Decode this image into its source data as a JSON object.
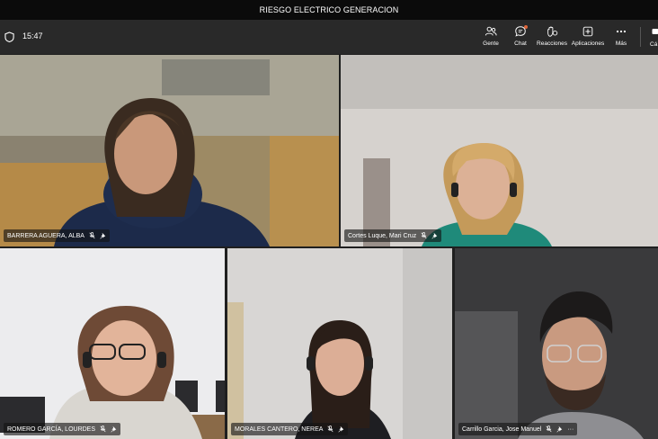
{
  "window": {
    "title": "RIESGO ELECTRICO GENERACION"
  },
  "toolbar": {
    "timer": "15:47",
    "buttons": [
      {
        "label": "Gente",
        "icon": "people-icon"
      },
      {
        "label": "Chat",
        "icon": "chat-icon"
      },
      {
        "label": "Reacciones",
        "icon": "reactions-icon"
      },
      {
        "label": "Aplicaciones",
        "icon": "apps-icon"
      },
      {
        "label": "Más",
        "icon": "more-icon"
      }
    ],
    "camera_label": "Cá"
  },
  "participants": [
    {
      "name": "BARRERA AGUERA, ALBA",
      "muted": true,
      "pinned": true
    },
    {
      "name": "Cortes Luque, Mari Cruz",
      "muted": true,
      "pinned": true
    },
    {
      "name": "ROMERO GARCÍA, LOURDES",
      "muted": true,
      "pinned": true
    },
    {
      "name": "MORALES CANTERO, NEREA",
      "muted": true,
      "pinned": true
    },
    {
      "name": "Carrillo Garcia, Jose Manuel",
      "muted": true,
      "pinned": true,
      "more": "···"
    }
  ],
  "colors": {
    "titlebar": "#0b0b0b",
    "toolbar": "#292929",
    "chat_badge": "#e0663a"
  }
}
